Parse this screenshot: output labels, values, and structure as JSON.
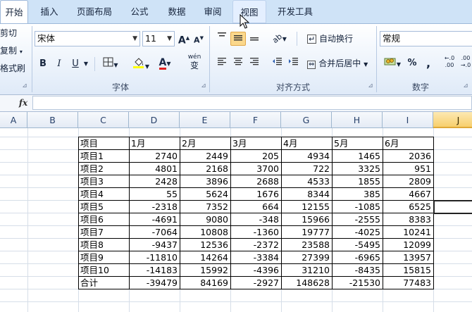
{
  "tabs": [
    {
      "label": "开始",
      "state": "active"
    },
    {
      "label": "插入",
      "state": ""
    },
    {
      "label": "页面布局",
      "state": ""
    },
    {
      "label": "公式",
      "state": ""
    },
    {
      "label": "数据",
      "state": ""
    },
    {
      "label": "审阅",
      "state": ""
    },
    {
      "label": "视图",
      "state": "hover"
    },
    {
      "label": "开发工具",
      "state": ""
    }
  ],
  "clipboard": {
    "cut": "剪切",
    "copy": "复制",
    "format_painter": "格式刷"
  },
  "font": {
    "name": "宋体",
    "size": "11",
    "grow": "A",
    "shrink": "A",
    "bold": "B",
    "italic": "I",
    "underline": "U",
    "font_color_glyph": "A",
    "phonetic": "wén",
    "phonetic_char": "变",
    "group_label": "字体"
  },
  "alignment": {
    "wrap_text": "自动换行",
    "merge_center": "合并后居中",
    "group_label": "对齐方式"
  },
  "number": {
    "format": "常规",
    "percent": "%",
    "comma": ",",
    "inc_decimal": "←.0 .00",
    "dec_decimal": ".00 →.0",
    "group_label": "数字"
  },
  "formula_bar": {
    "fx": "fx",
    "value": ""
  },
  "columns": [
    "A",
    "B",
    "C",
    "D",
    "E",
    "F",
    "G",
    "H",
    "I",
    "J"
  ],
  "table": {
    "headers": [
      "项目",
      "1月",
      "2月",
      "3月",
      "4月",
      "5月",
      "6月"
    ],
    "rows": [
      [
        "项目1",
        "2740",
        "2449",
        "205",
        "4934",
        "1465",
        "2036"
      ],
      [
        "项目2",
        "4801",
        "2168",
        "3700",
        "722",
        "3325",
        "951"
      ],
      [
        "项目3",
        "2428",
        "3896",
        "2688",
        "4533",
        "1855",
        "2809"
      ],
      [
        "项目4",
        "55",
        "5624",
        "1676",
        "8344",
        "385",
        "4667"
      ],
      [
        "项目5",
        "-2318",
        "7352",
        "664",
        "12155",
        "-1085",
        "6525"
      ],
      [
        "项目6",
        "-4691",
        "9080",
        "-348",
        "15966",
        "-2555",
        "8383"
      ],
      [
        "项目7",
        "-7064",
        "10808",
        "-1360",
        "19777",
        "-4025",
        "10241"
      ],
      [
        "项目8",
        "-9437",
        "12536",
        "-2372",
        "23588",
        "-5495",
        "12099"
      ],
      [
        "项目9",
        "-11810",
        "14264",
        "-3384",
        "27399",
        "-6965",
        "13957"
      ],
      [
        "项目10",
        "-14183",
        "15992",
        "-4396",
        "31210",
        "-8435",
        "15815"
      ],
      [
        "合计",
        "-39479",
        "84169",
        "-2927",
        "148628",
        "-21530",
        "77483"
      ]
    ]
  },
  "colors": {
    "tab_bar": "#cfe3f7",
    "selected_button": "#fbd88c",
    "selected_column": "#f7cf6c",
    "grid_line": "#d6dee8"
  }
}
